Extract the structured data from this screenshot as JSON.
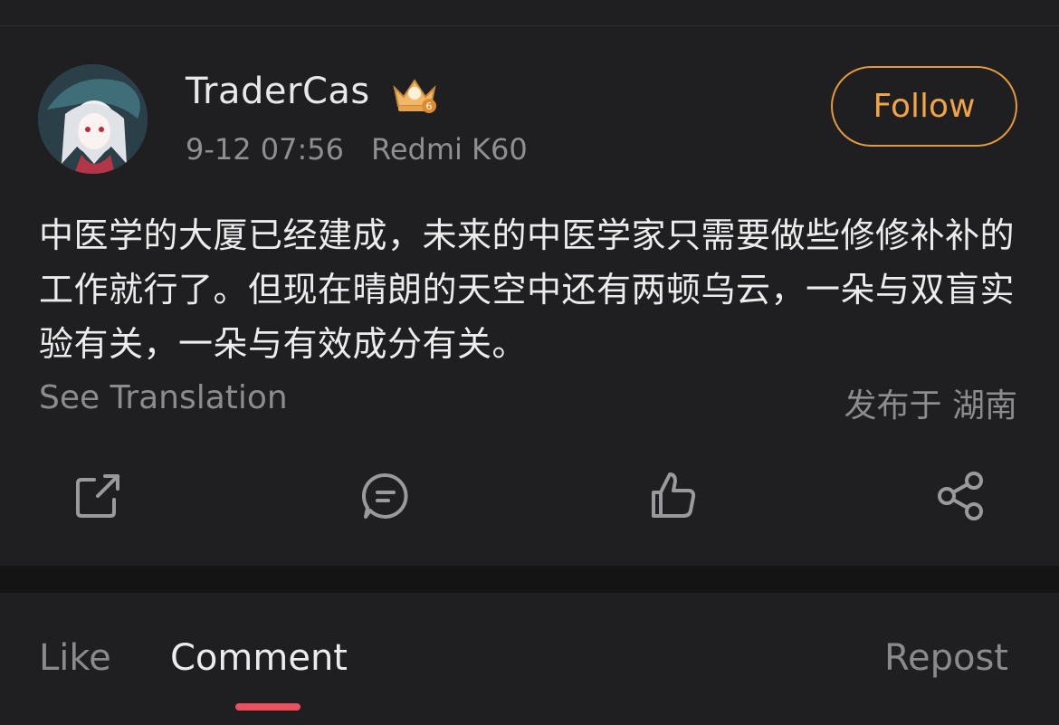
{
  "post": {
    "author": {
      "name": "TraderCas",
      "badge_level": "6"
    },
    "meta": {
      "time": "9-12 07:56",
      "device": "Redmi K60"
    },
    "follow_label": "Follow",
    "text": "中医学的大厦已经建成，未来的中医学家只需要做些修修补补的工作就行了。但现在晴朗的天空中还有两顿乌云，一朵与双盲实验有关，一朵与有效成分有关。",
    "see_translation": "See Translation",
    "location": "发布于 湖南"
  },
  "actions": [
    {
      "icon": "share-external-icon"
    },
    {
      "icon": "comment-icon"
    },
    {
      "icon": "thumbs-up-icon"
    },
    {
      "icon": "share-nodes-icon"
    }
  ],
  "tabs": {
    "like": "Like",
    "comment": "Comment",
    "repost": "Repost",
    "active": "comment"
  },
  "colors": {
    "background": "#1f1f21",
    "accent_follow": "#f0a446",
    "tab_indicator": "#ee4f5f"
  }
}
